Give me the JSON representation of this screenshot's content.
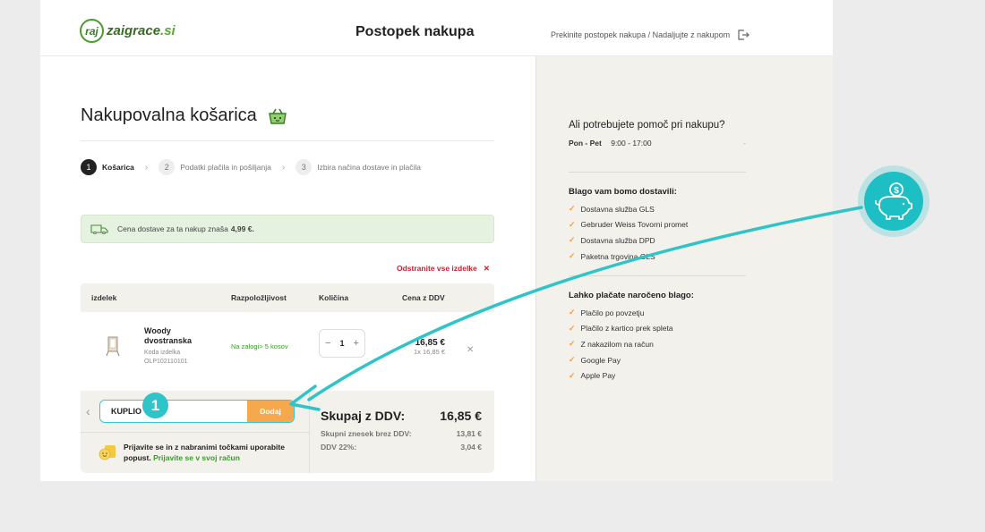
{
  "header": {
    "logo_prefix": "raj",
    "logo_main": "zaigrace",
    "logo_tld": ".si",
    "title": "Postopek nakupa",
    "exit_link": "Prekinite postopek nakupa / Nadaljujte z nakupom"
  },
  "cart": {
    "title": "Nakupovalna košarica",
    "steps": [
      {
        "num": "1",
        "label": "Košarica"
      },
      {
        "num": "2",
        "label": "Podatki plačila in pošiljanja"
      },
      {
        "num": "3",
        "label": "Izbira načina dostave in plačila"
      }
    ],
    "delivery_text": "Cena dostave za ta nakup znaša",
    "delivery_price": "4,99 €.",
    "remove_all": "Odstranite vse izdelke",
    "columns": {
      "product": "izdelek",
      "availability": "Razpoložljivost",
      "quantity": "Količina",
      "price": "Cena z DDV"
    },
    "item": {
      "name": "Woody dvostranska",
      "code_label": "Koda izdelka",
      "code": "OLP102110101",
      "availability": "Na zalogi> 5 kosov",
      "quantity": "1",
      "price": "16,85 €",
      "unit_price": "1x 16,85 €"
    },
    "coupon": {
      "value": "KUPLIO",
      "button": "Dodaj"
    },
    "points_text": "Prijavite se in z nabranimi točkami uporabite popust.",
    "points_link": "Prijavite se v svoj račun",
    "summary": {
      "total_label": "Skupaj z DDV:",
      "total_value": "16,85 €",
      "net_label": "Skupni znesek brez DDV:",
      "net_value": "13,81 €",
      "vat_label": "DDV 22%:",
      "vat_value": "3,04 €"
    }
  },
  "sidebar": {
    "help_title": "Ali potrebujete pomoč pri nakupu?",
    "hours_days": "Pon - Pet",
    "hours_time": "9:00 - 17:00",
    "hours_dash": "-",
    "delivery_title": "Blago vam bomo dostavili:",
    "delivery_options": [
      "Dostavna služba GLS",
      "Gebruder Weiss Tovorni promet",
      "Dostavna služba DPD",
      "Paketna trgovina GLS"
    ],
    "payment_title": "Lahko plačate naročeno blago:",
    "payment_options": [
      "Plačilo po povzetju",
      "Plačilo z kartico prek spleta",
      "Z nakazilom na račun",
      "Google Pay",
      "Apple Pay"
    ]
  },
  "annotation": {
    "badge": "1"
  },
  "colors": {
    "accent_teal": "#2fc4c8",
    "orange": "#f6a84c",
    "green": "#3a9a2a",
    "red": "#c81e2e"
  }
}
